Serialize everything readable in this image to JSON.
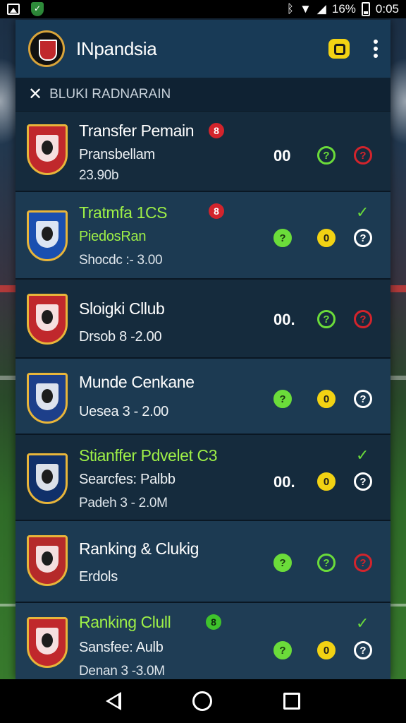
{
  "status_bar": {
    "battery_percent": "16%",
    "time": "0:05",
    "icons": [
      "image-icon",
      "shield-check-icon",
      "bluetooth-icon",
      "wifi-icon",
      "signal-icon",
      "battery-icon"
    ]
  },
  "app_bar": {
    "title": "INpandsia",
    "icons": [
      "club-logo-icon",
      "notification-icon",
      "more-vert-icon"
    ]
  },
  "sub_bar": {
    "close_label": "✕",
    "title": "BLUKI RADNARAIN"
  },
  "rows": [
    {
      "title": "Transfer Pemain",
      "title_color": "white",
      "badge": "8",
      "badge_color": "#d3242c",
      "line2": "Pransbellam",
      "line3": "23.90b",
      "score": "00",
      "buttons": [
        {
          "style": "outline-green",
          "glyph": "?"
        },
        {
          "style": "outline-red",
          "glyph": "?"
        }
      ],
      "check": ""
    },
    {
      "title": "Tratmfa 1CS",
      "title_color": "green",
      "badge": "8",
      "badge_color": "#d3242c",
      "line2": "PiedosRan",
      "line3": "Shocdc :- 3.00",
      "score": "",
      "buttons": [
        {
          "style": "fill-green",
          "glyph": "?"
        },
        {
          "style": "fill-yellow",
          "glyph": "0"
        },
        {
          "style": "outline-white",
          "glyph": "?"
        }
      ],
      "check": "✓"
    },
    {
      "title": "Sloigki Cllub",
      "title_color": "white",
      "badge": "",
      "line2": "Drsob 8 -2.00",
      "line3": "",
      "score": "00.",
      "buttons": [
        {
          "style": "outline-green",
          "glyph": "?"
        },
        {
          "style": "outline-red",
          "glyph": "?"
        }
      ],
      "check": ""
    },
    {
      "title": "Munde Cenkane",
      "title_color": "white",
      "badge": "",
      "line2": "Uesea 3 - 2.00",
      "line3": "",
      "score": "",
      "buttons": [
        {
          "style": "fill-green",
          "glyph": "?"
        },
        {
          "style": "fill-yellow",
          "glyph": "0"
        },
        {
          "style": "outline-white",
          "glyph": "?"
        }
      ],
      "check": ""
    },
    {
      "title": "Stianffer Pdvelet C3",
      "title_color": "green",
      "badge": "",
      "line2": "Searcfes: Palbb",
      "line3": "Padeh 3 - 2.0M",
      "score": "00.",
      "buttons": [
        {
          "style": "fill-yellow",
          "glyph": "0"
        },
        {
          "style": "outline-white",
          "glyph": "?"
        }
      ],
      "check": "✓"
    },
    {
      "title": "Ranking & Clukig",
      "title_color": "white",
      "badge": "",
      "line2": "Erdols",
      "line3": "",
      "score": "",
      "buttons": [
        {
          "style": "fill-green",
          "glyph": "?"
        },
        {
          "style": "outline-green",
          "glyph": "?"
        },
        {
          "style": "outline-red",
          "glyph": "?"
        }
      ],
      "check": ""
    },
    {
      "title": "Ranking Clull",
      "title_color": "green",
      "badge": "8",
      "badge_color": "#3fc32c",
      "line2": "Sansfee: Aulb",
      "line3": "Denan 3 -3.0M",
      "score": "",
      "buttons": [
        {
          "style": "fill-green",
          "glyph": "?"
        },
        {
          "style": "fill-yellow",
          "glyph": "0"
        },
        {
          "style": "outline-white",
          "glyph": "?"
        }
      ],
      "check": "✓"
    }
  ],
  "nav_bar": {
    "icons": [
      "back-icon",
      "home-icon",
      "recents-icon"
    ]
  }
}
